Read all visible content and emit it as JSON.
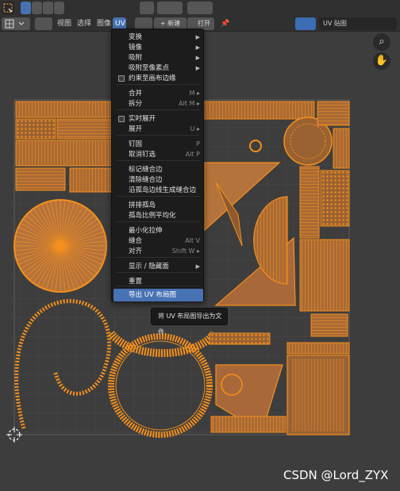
{
  "header": {
    "menu_view": "视图",
    "menu_select": "选择",
    "menu_image": "图像",
    "menu_uv": "UV",
    "new_button": "+ 新建",
    "open_button": "打开",
    "uv_map_name": "UV 贴图"
  },
  "menu": {
    "items": [
      {
        "label": "变换",
        "shortcut": "",
        "submenu": true,
        "checkbox": false
      },
      {
        "label": "镜像",
        "shortcut": "",
        "submenu": true,
        "checkbox": false
      },
      {
        "label": "吸附",
        "shortcut": "",
        "submenu": true,
        "checkbox": false
      },
      {
        "label": "吸附至像素点",
        "shortcut": "",
        "submenu": true,
        "checkbox": false
      },
      {
        "label": "约束至画布边缘",
        "shortcut": "",
        "submenu": false,
        "checkbox": true
      },
      {
        "label": "合并",
        "shortcut": "M",
        "submenu": true,
        "checkbox": false
      },
      {
        "label": "拆分",
        "shortcut": "Alt M",
        "submenu": true,
        "checkbox": false
      },
      {
        "label": "实时展开",
        "shortcut": "",
        "submenu": false,
        "checkbox": true
      },
      {
        "label": "展开",
        "shortcut": "U",
        "submenu": true,
        "checkbox": false
      },
      {
        "label": "钉固",
        "shortcut": "P",
        "submenu": false,
        "checkbox": false
      },
      {
        "label": "取消钉选",
        "shortcut": "Alt P",
        "submenu": false,
        "checkbox": false
      },
      {
        "label": "标记缝合边",
        "shortcut": "",
        "submenu": false,
        "checkbox": false
      },
      {
        "label": "清除缝合边",
        "shortcut": "",
        "submenu": false,
        "checkbox": false
      },
      {
        "label": "沿孤岛边线生成缝合边",
        "shortcut": "",
        "submenu": false,
        "checkbox": false
      },
      {
        "label": "拼排孤岛",
        "shortcut": "",
        "submenu": false,
        "checkbox": false
      },
      {
        "label": "孤岛比例平均化",
        "shortcut": "",
        "submenu": false,
        "checkbox": false
      },
      {
        "label": "最小化拉伸",
        "shortcut": "",
        "submenu": false,
        "checkbox": false
      },
      {
        "label": "缝合",
        "shortcut": "Alt V",
        "submenu": false,
        "checkbox": false
      },
      {
        "label": "对齐",
        "shortcut": "Shift W",
        "submenu": true,
        "checkbox": false
      },
      {
        "label": "显示 / 隐藏面",
        "shortcut": "",
        "submenu": true,
        "checkbox": false
      },
      {
        "label": "重置",
        "shortcut": "",
        "submenu": false,
        "checkbox": false
      },
      {
        "label": "导出 UV 布局图",
        "shortcut": "",
        "submenu": false,
        "checkbox": false,
        "selected": true
      }
    ]
  },
  "tooltip": "将 UV 布局图导出为文件.",
  "watermark": "CSDN @Lord_ZYX",
  "colors": {
    "accent": "#4772b3",
    "uv_edge": "#f5901e",
    "uv_face": "#b5733c",
    "background": "#3d3d3d",
    "menu_bg": "#1c1c1c"
  },
  "icons": [
    "zoom-icon",
    "hand-pan-icon",
    "cursor-icon",
    "checkbox-icon",
    "submenu-arrow-icon",
    "pin-icon"
  ]
}
